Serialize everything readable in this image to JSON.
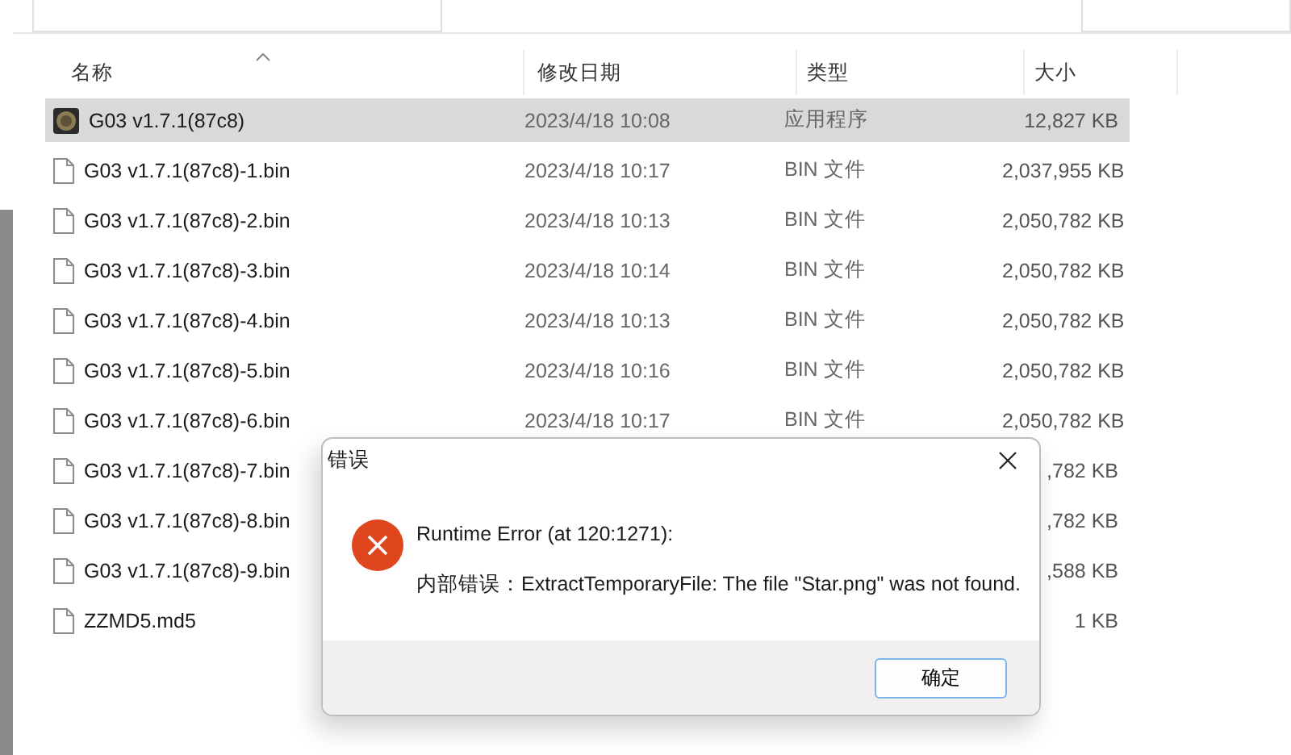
{
  "columns": [
    {
      "label": "名称",
      "sorted": true
    },
    {
      "label": "修改日期",
      "sorted": false
    },
    {
      "label": "类型",
      "sorted": false
    },
    {
      "label": "大小",
      "sorted": false
    }
  ],
  "files": [
    {
      "kind": "app",
      "name": "G03 v1.7.1(87c8)",
      "date": "2023/4/18 10:08",
      "type": "应用程序",
      "size": "12,827 KB",
      "selected": true
    },
    {
      "kind": "file",
      "name": "G03 v1.7.1(87c8)-1.bin",
      "date": "2023/4/18 10:17",
      "type": "BIN 文件",
      "size": "2,037,955 KB",
      "selected": false
    },
    {
      "kind": "file",
      "name": "G03 v1.7.1(87c8)-2.bin",
      "date": "2023/4/18 10:13",
      "type": "BIN 文件",
      "size": "2,050,782 KB",
      "selected": false
    },
    {
      "kind": "file",
      "name": "G03 v1.7.1(87c8)-3.bin",
      "date": "2023/4/18 10:14",
      "type": "BIN 文件",
      "size": "2,050,782 KB",
      "selected": false
    },
    {
      "kind": "file",
      "name": "G03 v1.7.1(87c8)-4.bin",
      "date": "2023/4/18 10:13",
      "type": "BIN 文件",
      "size": "2,050,782 KB",
      "selected": false
    },
    {
      "kind": "file",
      "name": "G03 v1.7.1(87c8)-5.bin",
      "date": "2023/4/18 10:16",
      "type": "BIN 文件",
      "size": "2,050,782 KB",
      "selected": false
    },
    {
      "kind": "file",
      "name": "G03 v1.7.1(87c8)-6.bin",
      "date": "2023/4/18 10:17",
      "type": "BIN 文件",
      "size": "2,050,782 KB",
      "selected": false
    },
    {
      "kind": "file",
      "name": "G03 v1.7.1(87c8)-7.bin",
      "size": ",782 KB",
      "selected": false
    },
    {
      "kind": "file",
      "name": "G03 v1.7.1(87c8)-8.bin",
      "size": ",782 KB",
      "selected": false
    },
    {
      "kind": "file",
      "name": "G03 v1.7.1(87c8)-9.bin",
      "size": ",588 KB",
      "selected": false
    },
    {
      "kind": "file",
      "name": "ZZMD5.md5",
      "size": "1 KB",
      "selected": false
    }
  ],
  "dialog": {
    "title": "错误",
    "kind": "error",
    "heading": "Runtime Error (at 120:1271):",
    "message": "内部错误：ExtractTemporaryFile: The file \"Star.png\" was not found.",
    "button": "确定"
  }
}
